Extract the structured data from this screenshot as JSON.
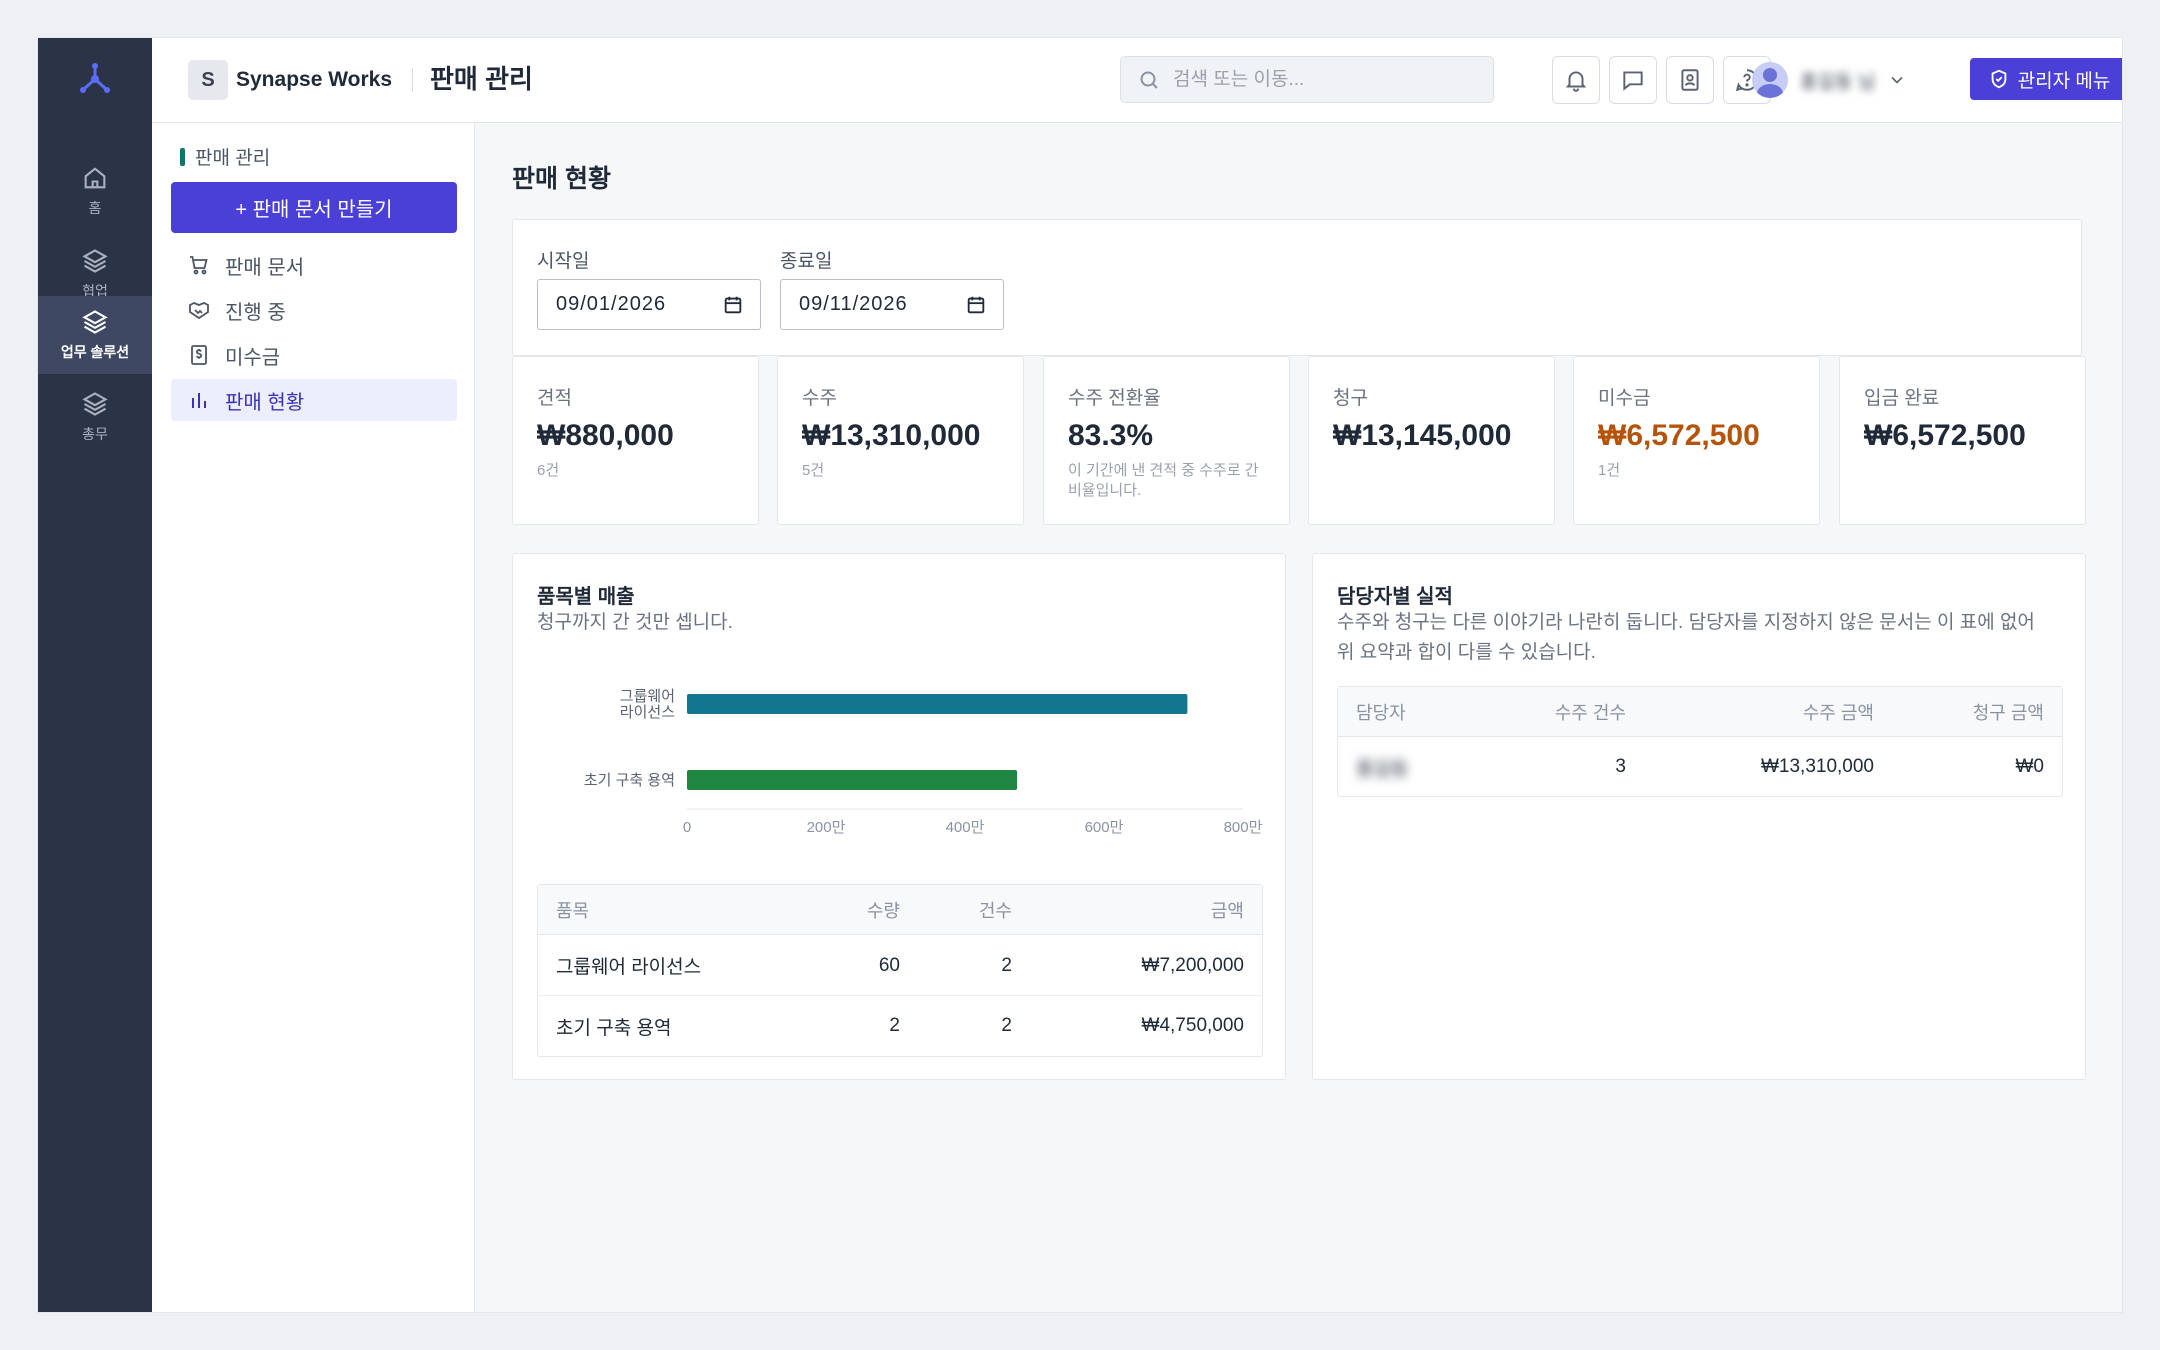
{
  "rail": {
    "items": [
      {
        "label": "홈",
        "icon": "home-icon"
      },
      {
        "label": "협업",
        "icon": "layers-icon"
      },
      {
        "label": "업무 솔루션",
        "icon": "layers-icon"
      },
      {
        "label": "총무",
        "icon": "layers-icon"
      }
    ],
    "active": "업무 솔루션"
  },
  "header": {
    "brand_initial": "S",
    "brand_name": "Synapse Works",
    "page_title": "판매 관리",
    "search_placeholder": "검색 또는 이동...",
    "user_name": "홍길동 님",
    "admin_label": "관리자 메뉴"
  },
  "sidenav": {
    "section_title": "판매 관리",
    "create_label": "+ 판매 문서 만들기",
    "items": [
      {
        "label": "판매 문서",
        "icon": "cart-icon"
      },
      {
        "label": "진행 중",
        "icon": "handshake-icon"
      },
      {
        "label": "미수금",
        "icon": "dollar-doc-icon"
      },
      {
        "label": "판매 현황",
        "icon": "bar-chart-icon"
      }
    ],
    "active": "판매 현황"
  },
  "main": {
    "title": "판매 현황",
    "filters": {
      "start_label": "시작일",
      "start_value": "09/01/2026",
      "end_label": "종료일",
      "end_value": "09/11/2026"
    },
    "kpis": [
      {
        "label": "견적",
        "value": "₩880,000",
        "sub": "6건"
      },
      {
        "label": "수주",
        "value": "₩13,310,000",
        "sub": "5건"
      },
      {
        "label": "수주 전환율",
        "value": "83.3%",
        "sub": "이 기간에 낸 견적 중 수주로 간 비율입니다."
      },
      {
        "label": "청구",
        "value": "₩13,145,000",
        "sub": ""
      },
      {
        "label": "미수금",
        "value": "₩6,572,500",
        "sub": "1건",
        "color": "#b45309"
      },
      {
        "label": "입금 완료",
        "value": "₩6,572,500",
        "sub": ""
      }
    ],
    "product_panel": {
      "title": "품목별 매출",
      "desc": "청구까지 간 것만 셉니다.",
      "table": {
        "headers": [
          "품목",
          "수량",
          "건수",
          "금액"
        ],
        "rows": [
          [
            "그룹웨어 라이선스",
            "60",
            "2",
            "₩7,200,000"
          ],
          [
            "초기 구축 용역",
            "2",
            "2",
            "₩4,750,000"
          ]
        ]
      }
    },
    "staff_panel": {
      "title": "담당자별 실적",
      "desc_line1": "수주와 청구는 다른 이야기라 나란히 둡니다. 담당자를 지정하지 않은 문서는 이 표에 없어",
      "desc_line2": "위 요약과 합이 다를 수 있습니다.",
      "table": {
        "headers": [
          "담당자",
          "수주 건수",
          "수주 금액",
          "청구 금액"
        ],
        "rows": [
          [
            "홍길동",
            "3",
            "₩13,310,000",
            "₩0"
          ]
        ]
      }
    }
  },
  "chart_data": {
    "type": "bar",
    "orientation": "horizontal",
    "categories": [
      "그룹웨어 라이선스",
      "초기 구축 용역"
    ],
    "category_lines": [
      [
        "그룹웨어",
        "라이선스"
      ],
      [
        "초기 구축 용역"
      ]
    ],
    "values": [
      7200000,
      4750000
    ],
    "colors": [
      "#127691",
      "#1e8543"
    ],
    "xlim": [
      0,
      8000000
    ],
    "xticks": [
      0,
      2000000,
      4000000,
      6000000,
      8000000
    ],
    "xtick_labels": [
      "0",
      "200만",
      "400만",
      "600만",
      "800만"
    ],
    "grid": false
  }
}
